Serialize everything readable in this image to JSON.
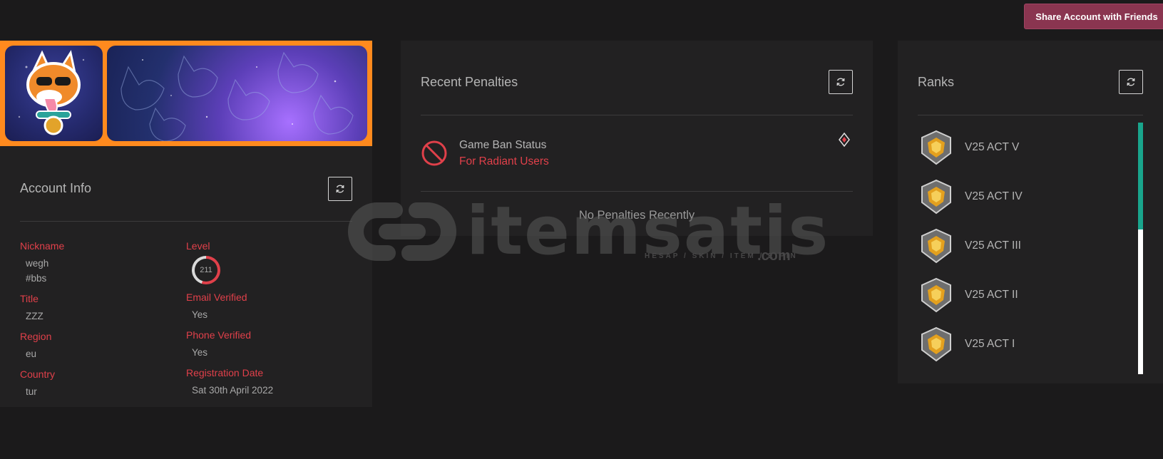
{
  "share_button": {
    "label": "Share Account with Friends"
  },
  "account_info": {
    "title": "Account Info",
    "left_fields": [
      {
        "label": "Nickname",
        "value": "wegh",
        "value2": "#bbs"
      },
      {
        "label": "Title",
        "value": "ZZZ"
      },
      {
        "label": "Region",
        "value": "eu"
      },
      {
        "label": "Country",
        "value": "tur"
      }
    ],
    "level": {
      "label": "Level",
      "value": "211"
    },
    "email": {
      "label": "Email Verified",
      "value": "Yes"
    },
    "phone": {
      "label": "Phone Verified",
      "value": "Yes"
    },
    "registration": {
      "label": "Registration Date",
      "value": "Sat 30th April 2022"
    }
  },
  "penalties": {
    "title": "Recent Penalties",
    "item_title": "Game Ban Status",
    "item_sub": "For Radiant Users",
    "empty_text": "No Penalties Recently"
  },
  "ranks": {
    "title": "Ranks",
    "items": [
      {
        "name": "V25 ACT V"
      },
      {
        "name": "V25 ACT IV"
      },
      {
        "name": "V25 ACT III"
      },
      {
        "name": "V25 ACT II"
      },
      {
        "name": "V25 ACT I"
      }
    ]
  },
  "watermark": {
    "brand": "itemsatis",
    "tagline": "HESAP / SKIN / ITEM / E-PIN",
    "suffix": ".com"
  },
  "colors": {
    "accent_red": "#e0404a",
    "banner_orange": "#ff8a1e",
    "share_button": "#8a3550",
    "scroll_thumb": "#19a58c"
  }
}
